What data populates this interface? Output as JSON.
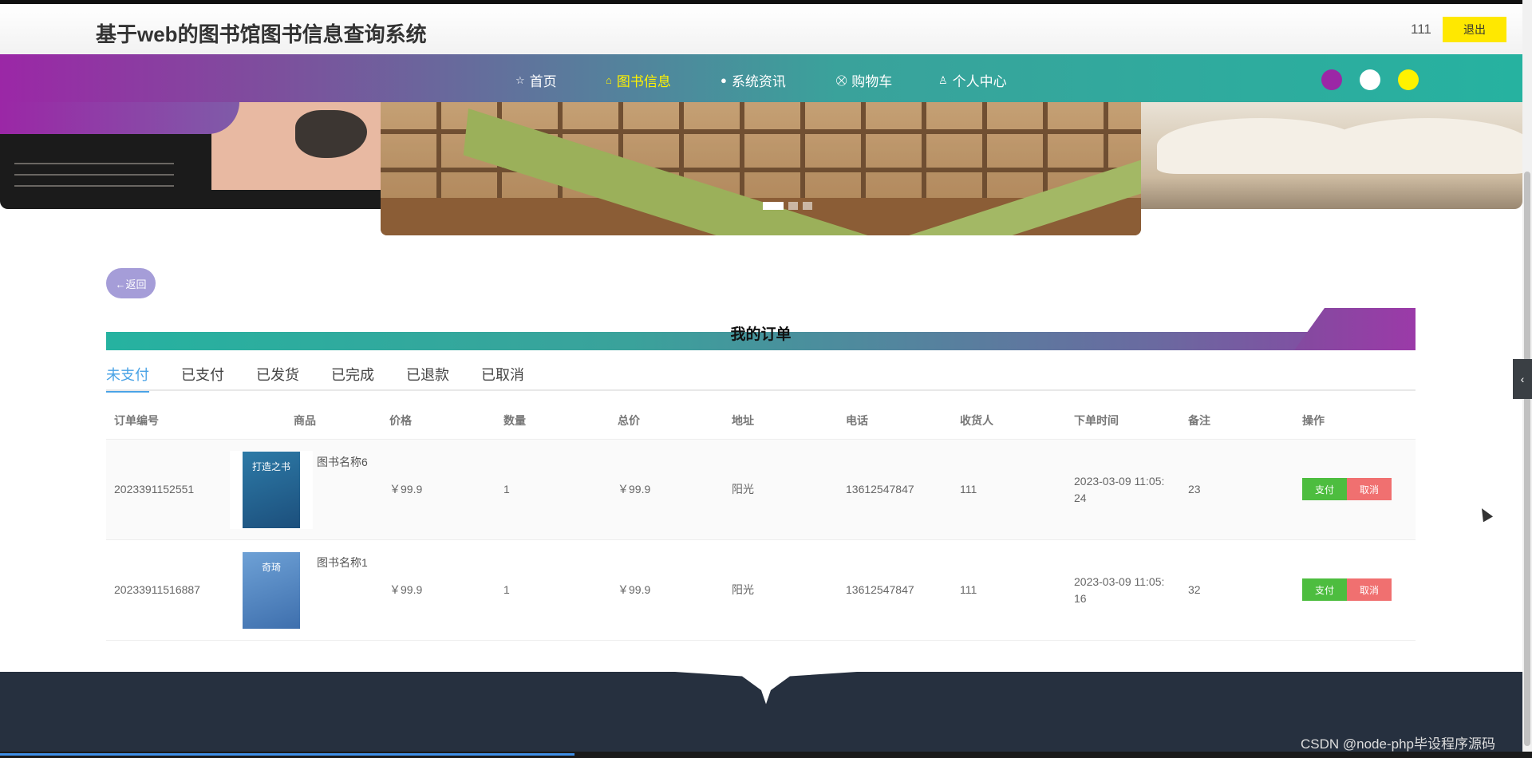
{
  "header": {
    "title": "基于web的图书馆图书信息查询系统",
    "username": "111",
    "logout_label": "退出"
  },
  "nav": {
    "items": [
      {
        "icon": "☆",
        "label": "首页"
      },
      {
        "icon": "⌂",
        "label": "图书信息"
      },
      {
        "icon": "●",
        "label": "系统资讯"
      },
      {
        "icon": "⛒",
        "label": "购物车"
      },
      {
        "icon": "♙",
        "label": "个人中心"
      }
    ],
    "theme_colors": [
      "#9b27a6",
      "#ffffff",
      "#fff200"
    ]
  },
  "back_label": "←返回",
  "section_title": "我的订单",
  "tabs": [
    "未支付",
    "已支付",
    "已发货",
    "已完成",
    "已退款",
    "已取消"
  ],
  "table": {
    "columns": [
      "订单编号",
      "商品",
      "价格",
      "数量",
      "总价",
      "地址",
      "电话",
      "收货人",
      "下单时间",
      "备注",
      "操作"
    ],
    "rows": [
      {
        "order_no": "2023391152551",
        "product": "图书名称6",
        "cover_text": "打造之书",
        "price": "￥99.9",
        "qty": "1",
        "total": "￥99.9",
        "address": "阳光",
        "phone": "13612547847",
        "receiver": "111",
        "time_line1": "2023-03-09 11:05:",
        "time_line2": "24",
        "note": "23",
        "pay_label": "支付",
        "cancel_label": "取消"
      },
      {
        "order_no": "20233911516887",
        "product": "图书名称1",
        "cover_text": "奇琦",
        "price": "￥99.9",
        "qty": "1",
        "total": "￥99.9",
        "address": "阳光",
        "phone": "13612547847",
        "receiver": "111",
        "time_line1": "2023-03-09 11:05:",
        "time_line2": "16",
        "note": "32",
        "pay_label": "支付",
        "cancel_label": "取消"
      }
    ]
  },
  "watermark": "CSDN @node-php毕设程序源码",
  "side_tab_icon": "‹"
}
